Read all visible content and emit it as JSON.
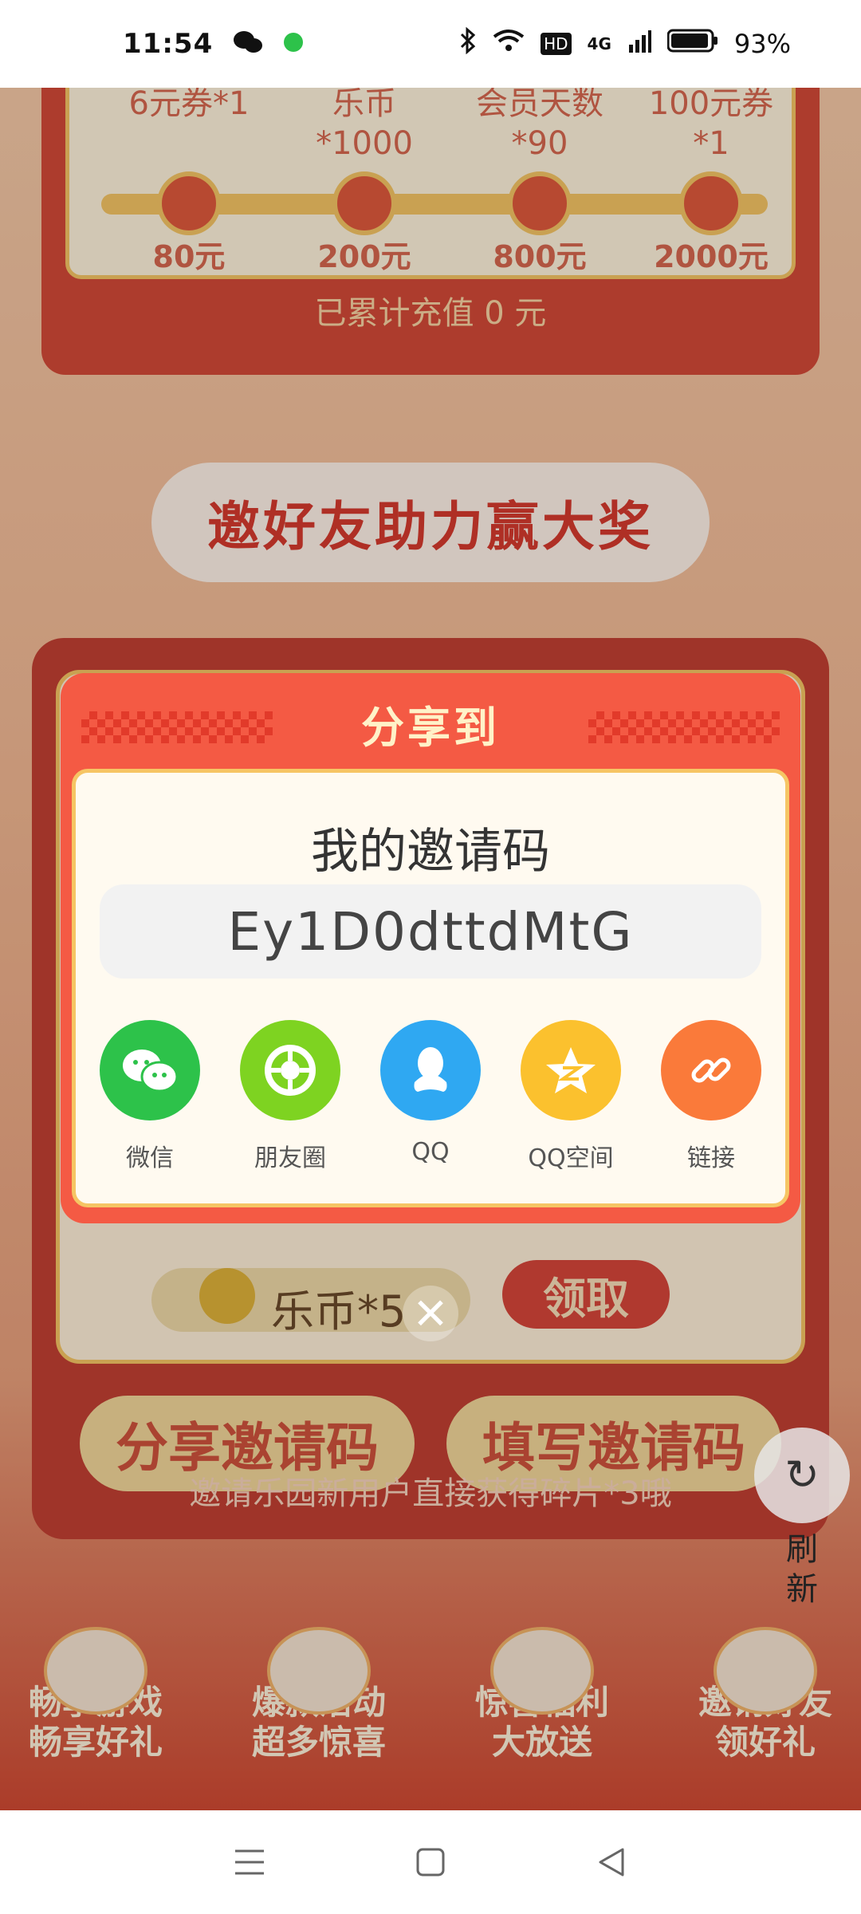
{
  "status_bar": {
    "time": "11:54",
    "battery": "93%",
    "network": "4G",
    "hd": "HD"
  },
  "rewards": {
    "items": [
      {
        "reward": "6元券*1",
        "amount": "80元"
      },
      {
        "reward": "乐币*1000",
        "amount": "200元"
      },
      {
        "reward": "会员天数*90",
        "amount": "800元"
      },
      {
        "reward": "100元券*1",
        "amount": "2000元"
      }
    ],
    "charged_text": "已累计充值 0 元"
  },
  "invite_banner": "邀好友助力赢大奖",
  "card": {
    "coins_text": "乐币*5",
    "claim_label": "领取",
    "share_code_btn": "分享邀请码",
    "fill_code_btn": "填写邀请码",
    "hint": "邀请乐园新用户直接获得碎片*3哦"
  },
  "refresh": {
    "label": "刷新"
  },
  "features": [
    {
      "line1": "畅享游戏",
      "line2": "畅享好礼"
    },
    {
      "line1": "爆款活动",
      "line2": "超多惊喜"
    },
    {
      "line1": "惊喜福利",
      "line2": "大放送"
    },
    {
      "line1": "邀请好友",
      "line2": "领好礼"
    }
  ],
  "modal": {
    "title": "分享到",
    "code_label": "我的邀请码",
    "code": "Ey1D0dttdMtG",
    "share_targets": [
      {
        "label": "微信",
        "icon": "wechat-icon",
        "color": "#2dc24a"
      },
      {
        "label": "朋友圈",
        "icon": "moments-icon",
        "color": "#7ed321"
      },
      {
        "label": "QQ",
        "icon": "qq-icon",
        "color": "#2fa8f2"
      },
      {
        "label": "QQ空间",
        "icon": "qzone-icon",
        "color": "#fbc12e"
      },
      {
        "label": "链接",
        "icon": "link-icon",
        "color": "#fa7a3a"
      }
    ]
  },
  "colors": {
    "modal_red": "#f45a44",
    "gold": "#f6c564"
  }
}
